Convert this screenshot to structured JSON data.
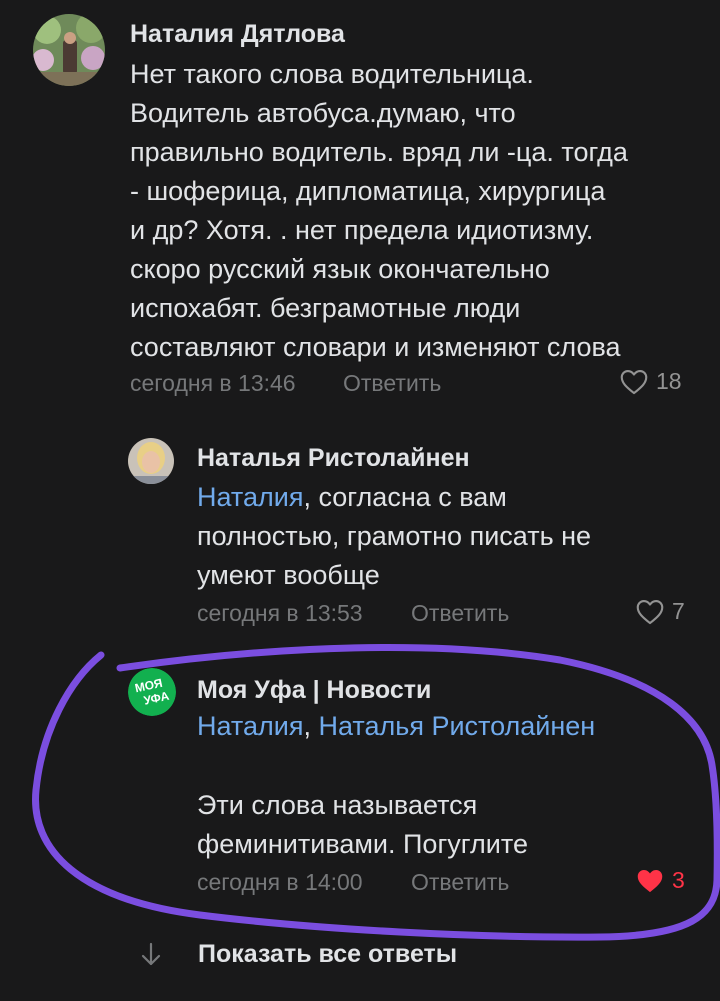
{
  "comments": [
    {
      "author": "Наталия Дятлова",
      "lines": [
        "Нет такого слова водительница.",
        "Водитель автобуса.думаю, что",
        "правильно водитель. вряд ли -ца. тогда",
        "- шоферица, дипломатица, хирургица",
        "и др? Хотя. . нет предела идиотизму.",
        "скоро русский язык окончательно",
        "испохабят. безграмотные люди",
        "составляют словари и изменяют слова"
      ],
      "time": "сегодня в 13:46",
      "reply_label": "Ответить",
      "likes": "18"
    },
    {
      "author": "Наталья Ристолайнен",
      "mention": "Наталия",
      "line1_rest": ", согласна с вам",
      "lines": [
        "полностью, грамотно писать не",
        "умеют вообще"
      ],
      "time": "сегодня в 13:53",
      "reply_label": "Ответить",
      "likes": "7"
    },
    {
      "author": "Моя Уфа | Новости",
      "avatar_text": [
        "МОЯ",
        "УФА"
      ],
      "mention1": "Наталия",
      "separator": ",",
      "mention2": "Наталья Ристолайнен",
      "lines": [
        "Эти слова называется",
        "феминитивами. Погуглите"
      ],
      "time": "сегодня в 14:00",
      "reply_label": "Ответить",
      "likes": "3",
      "liked": true
    }
  ],
  "show_all_label": "Показать все ответы",
  "colors": {
    "background": "#19191a",
    "text": "#e1e3e6",
    "secondary": "#76787a",
    "link": "#71aaeb",
    "like_active": "#ff3347",
    "annotation": "#7b4ee0"
  }
}
